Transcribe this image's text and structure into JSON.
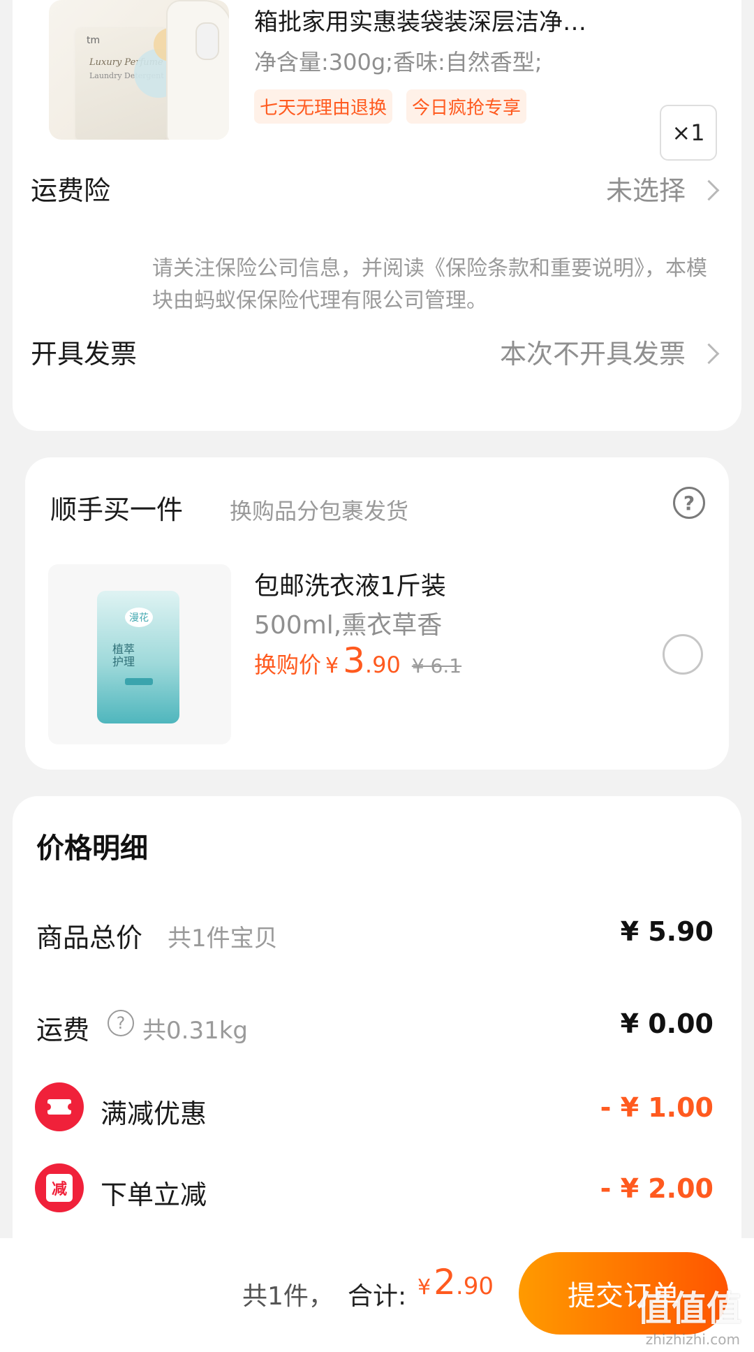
{
  "product": {
    "title": "箱批家用实惠装袋装深层洁净…",
    "spec": "净含量:300g;香味:自然香型;",
    "tags": [
      "七天无理由退换",
      "今日疯抢专享"
    ],
    "quantity": "×1",
    "image_text_brand": "tm",
    "image_text_line1": "Luxury Perfume",
    "image_text_line2": "Laundry Detergent"
  },
  "shipping_insurance": {
    "label": "运费险",
    "value": "未选择",
    "note": "请关注保险公司信息，并阅读《保险条款和重要说明》，本模块由蚂蚁保保险代理有限公司管理。"
  },
  "invoice": {
    "label": "开具发票",
    "value": "本次不开具发票"
  },
  "addon": {
    "title": "顺手买一件",
    "subtitle": "换购品分包裹发货",
    "name": "包邮洗衣液1斤装",
    "spec": "500ml,熏衣草香",
    "price_label": "换购价",
    "currency": "¥",
    "price_int": "3",
    "price_dec": ".90",
    "original_price": "¥ 6.1",
    "image_text_brand": "漫花",
    "image_text_label": "植萃\n护理"
  },
  "price_details": {
    "title": "价格明细",
    "goods_total_label": "商品总价",
    "goods_total_sub": "共1件宝贝",
    "goods_total_value": "¥ 5.90",
    "freight_label": "运费",
    "freight_sub": "共0.31kg",
    "freight_value": "¥ 0.00",
    "discount1_label": "满减优惠",
    "discount1_value": "- ¥ 1.00",
    "discount2_label": "下单立减",
    "discount2_value": "- ¥ 2.00",
    "discount2_icon_text": "减"
  },
  "footer": {
    "count": "共1件，",
    "total_label": "合计:",
    "currency": "¥",
    "total_int": "2",
    "total_dec": ".90",
    "submit_label": "提交订单",
    "watermark": "值值值",
    "watermark_sub": "zhizhizhi.com"
  },
  "colors": {
    "accent": "#ff5a1f",
    "tag_bg": "#fff1e8",
    "discount_red": "#f0213a",
    "button_start": "#ff9a00",
    "button_end": "#ff5500"
  }
}
